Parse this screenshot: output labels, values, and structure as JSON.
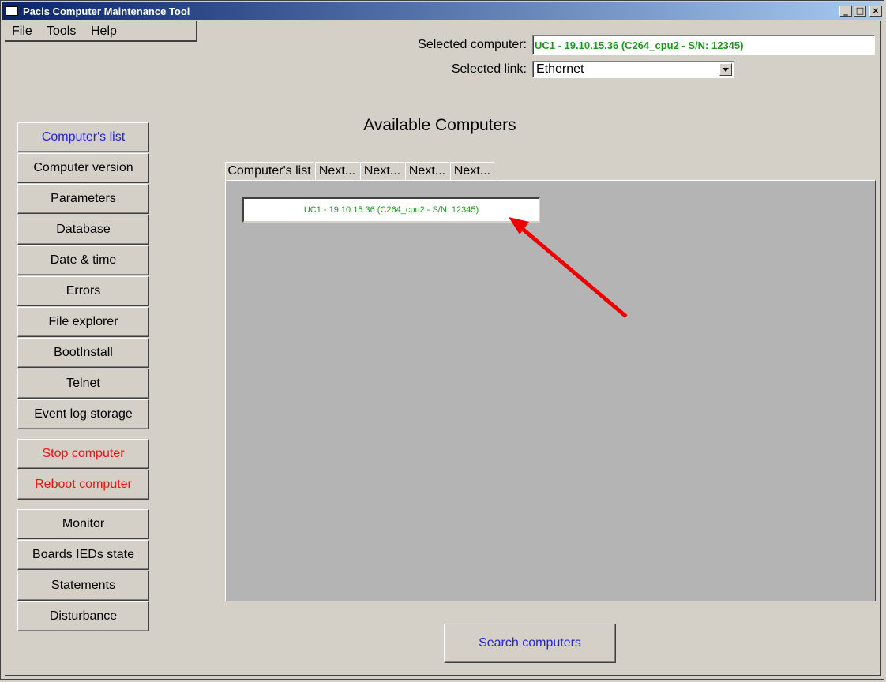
{
  "window": {
    "title": "Pacis Computer Maintenance Tool",
    "minimize": "_",
    "maximize": "□",
    "close": "×"
  },
  "menu": [
    "File",
    "Tools",
    "Help"
  ],
  "header": {
    "selected_computer_label": "Selected computer:",
    "selected_computer_value": "UC1 - 19.10.15.36 (C264_cpu2 - S/N: 12345)",
    "selected_link_label": "Selected link:",
    "selected_link_value": "Ethernet"
  },
  "main": {
    "heading": "Available Computers",
    "tabs": [
      "Computer's list",
      "Next...",
      "Next...",
      "Next...",
      "Next..."
    ],
    "computer_list": [
      "UC1 - 19.10.15.36 (C264_cpu2 - S/N: 12345)"
    ],
    "search_button": "Search computers"
  },
  "sidebar": {
    "group1": [
      "Computer's list",
      "Computer version",
      "Parameters",
      "Database",
      "Date & time",
      "Errors",
      "File explorer",
      "BootInstall",
      "Telnet",
      "Event log storage"
    ],
    "group2": [
      "Stop computer",
      "Reboot computer"
    ],
    "group3": [
      "Monitor",
      "Boards IEDs state",
      "Statements",
      "Disturbance"
    ]
  },
  "colors": {
    "active_blue": "#2222dd",
    "danger_red": "#ee1111",
    "computer_green": "#1a9a1a",
    "annotation_arrow": "#ee0000"
  }
}
